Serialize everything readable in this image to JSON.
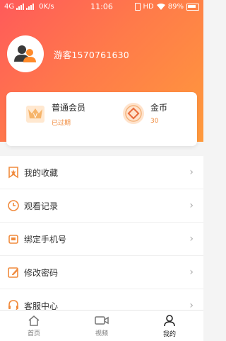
{
  "status_bar": {
    "network": "4G",
    "speed": "0K/s",
    "time": "11:06",
    "hd": "HD",
    "battery": "89%"
  },
  "profile": {
    "username": "游客1570761630",
    "avatar_icon": "user-group-icon"
  },
  "membership_card": {
    "member_title": "普通会员",
    "member_status": "已过期",
    "coin_title": "金币",
    "coin_value": "30"
  },
  "menu": {
    "items": [
      {
        "label": "我的收藏",
        "icon": "favorites-star-icon"
      },
      {
        "label": "观看记录",
        "icon": "history-clock-icon"
      },
      {
        "label": "绑定手机号",
        "icon": "phone-icon"
      },
      {
        "label": "修改密码",
        "icon": "edit-pencil-icon"
      },
      {
        "label": "客服中心",
        "icon": "headset-icon"
      }
    ],
    "chevron": "›"
  },
  "tab_bar": {
    "tabs": [
      {
        "label": "首页",
        "icon": "home-icon"
      },
      {
        "label": "视频",
        "icon": "video-camera-icon"
      },
      {
        "label": "我的",
        "icon": "profile-icon"
      }
    ],
    "active": "我的"
  },
  "colors": {
    "accent": "#f08a3c",
    "header_start": "#ff5a5a",
    "header_end": "#ff9a3c"
  }
}
